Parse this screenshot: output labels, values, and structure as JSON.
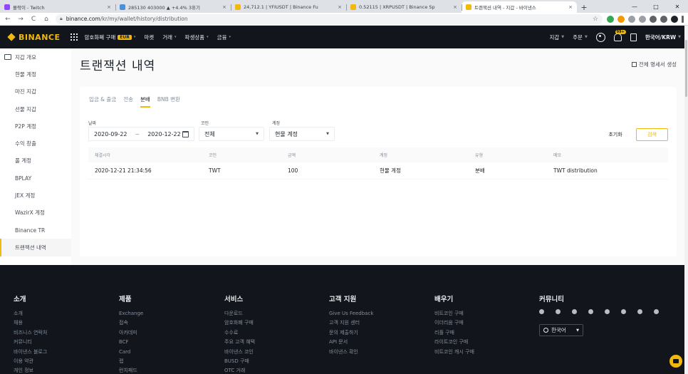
{
  "browser": {
    "tabs": [
      {
        "title": "몰락이 - Twitch",
        "favicon_color": "#9146ff",
        "active": false
      },
      {
        "title": "285130 403000 ▲ +4.4% 3휴기",
        "favicon_color": "#4a90d9",
        "active": false
      },
      {
        "title": "24,712.1 | YFIUSDT | Binance Fu",
        "favicon_color": "#f0b90b",
        "active": false
      },
      {
        "title": "0.52115 | XRPUSDT | Binance Sp",
        "favicon_color": "#f0b90b",
        "active": false
      },
      {
        "title": "트랜잭션 내역 - 지갑 - 바이낸스",
        "favicon_color": "#f0b90b",
        "active": true
      }
    ],
    "tab_close": "×",
    "new_tab": "+",
    "window_controls": [
      "—",
      "□",
      "✕"
    ],
    "url_host": "binance.com",
    "url_path": "/kr/my/wallet/history/distribution"
  },
  "header": {
    "logo": "BINANCE",
    "nav": [
      {
        "label": "암호화폐 구매",
        "badge": "EUR",
        "caret": "▾"
      },
      {
        "label": "마켓",
        "badge": "",
        "caret": ""
      },
      {
        "label": "거래",
        "badge": "",
        "caret": "▾"
      },
      {
        "label": "파생상품",
        "badge": "",
        "caret": "▾"
      },
      {
        "label": "금융",
        "badge": "",
        "caret": "▾"
      }
    ],
    "right": {
      "wallet": "지갑",
      "orders": "주문",
      "notifications_count": "99+",
      "language": "한국어/KRW"
    }
  },
  "sidebar": {
    "items": [
      {
        "label": "지갑 개요",
        "active": false,
        "top": true
      },
      {
        "label": "현물 계정",
        "active": false
      },
      {
        "label": "마진 지갑",
        "active": false
      },
      {
        "label": "선물 지갑",
        "active": false
      },
      {
        "label": "P2P 계정",
        "active": false
      },
      {
        "label": "수익 창출",
        "active": false
      },
      {
        "label": "풀 계정",
        "active": false
      },
      {
        "label": "BPLAY",
        "active": false
      },
      {
        "label": "JEX 계정",
        "active": false
      },
      {
        "label": "WazirX 계정",
        "active": false
      },
      {
        "label": "Binance TR",
        "active": false
      },
      {
        "label": "트랜잭션 내역",
        "active": true
      }
    ]
  },
  "main": {
    "title": "트랜잭션 내역",
    "generate_statement": "전체 명세서 생성",
    "tabs": [
      {
        "label": "입금 & 출금",
        "active": false
      },
      {
        "label": "전송",
        "active": false
      },
      {
        "label": "분배",
        "active": true
      },
      {
        "label": "BNB 변환",
        "active": false
      }
    ],
    "filters": {
      "date_label": "날짜",
      "date_start": "2020-09-22",
      "date_sep": "~",
      "date_end": "2020-12-22",
      "coin_label": "코인",
      "coin_value": "전체",
      "account_label": "계정",
      "account_value": "현물 계정",
      "reset_label": "초기화",
      "search_label": "검색"
    },
    "table": {
      "headers": [
        "체결시각",
        "코인",
        "금액",
        "계정",
        "유형",
        "메모"
      ],
      "rows": [
        [
          "2020-12-21 21:34:56",
          "TWT",
          "100",
          "현물 계정",
          "분배",
          "TWT distribution"
        ]
      ]
    }
  },
  "footer": {
    "columns": [
      {
        "heading": "소개",
        "links": [
          "소개",
          "채용",
          "비즈니스 연락처",
          "커뮤니티",
          "바이낸스 블로그",
          "이용 약관",
          "개인 정보"
        ]
      },
      {
        "heading": "제품",
        "links": [
          "Exchange",
          "접속",
          "아카데미",
          "BCF",
          "Card",
          "랩",
          "런치패드"
        ]
      },
      {
        "heading": "서비스",
        "links": [
          "다운로드",
          "암호화폐 구매",
          "수수료",
          "주요 고객 혜택",
          "바이낸스 코인",
          "BUSD 구매",
          "OTC 거래"
        ]
      },
      {
        "heading": "고객 지원",
        "links": [
          "Give Us Feedback",
          "고객 지원 센터",
          "문의 제출하기",
          "API 문서",
          "바이낸스 확인"
        ]
      },
      {
        "heading": "배우기",
        "links": [
          "비트코인 구매",
          "이더리움 구매",
          "리플 구매",
          "라이트코인 구매",
          "비트코인 캐시 구매"
        ]
      }
    ],
    "community_heading": "커뮤니티",
    "social_icons": [
      "telegram-icon",
      "facebook-icon",
      "twitter-icon",
      "reddit-icon",
      "instagram-icon",
      "coinmarketcap-icon",
      "vk-icon",
      "youtube-icon"
    ],
    "language": "한국어"
  },
  "colors": {
    "brand": "#f0b90b",
    "header_bg": "#12161c",
    "text_primary": "#1e2329",
    "text_secondary": "#848e9c"
  }
}
